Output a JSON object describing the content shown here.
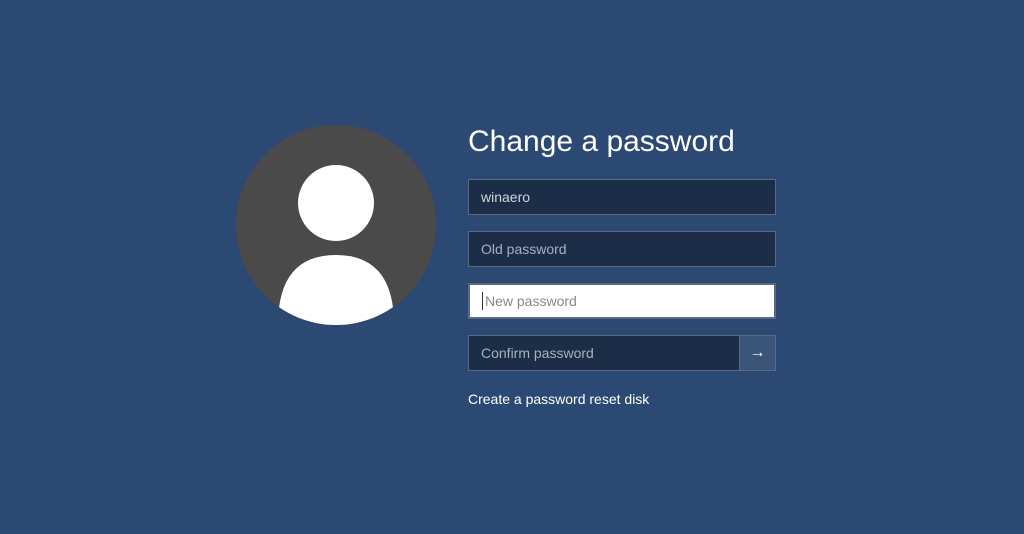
{
  "title": "Change a password",
  "username": {
    "value": "winaero"
  },
  "old_password": {
    "placeholder": "Old password"
  },
  "new_password": {
    "placeholder": "New password"
  },
  "confirm_password": {
    "placeholder": "Confirm password"
  },
  "submit_icon": "→",
  "reset_link": "Create a password reset disk"
}
